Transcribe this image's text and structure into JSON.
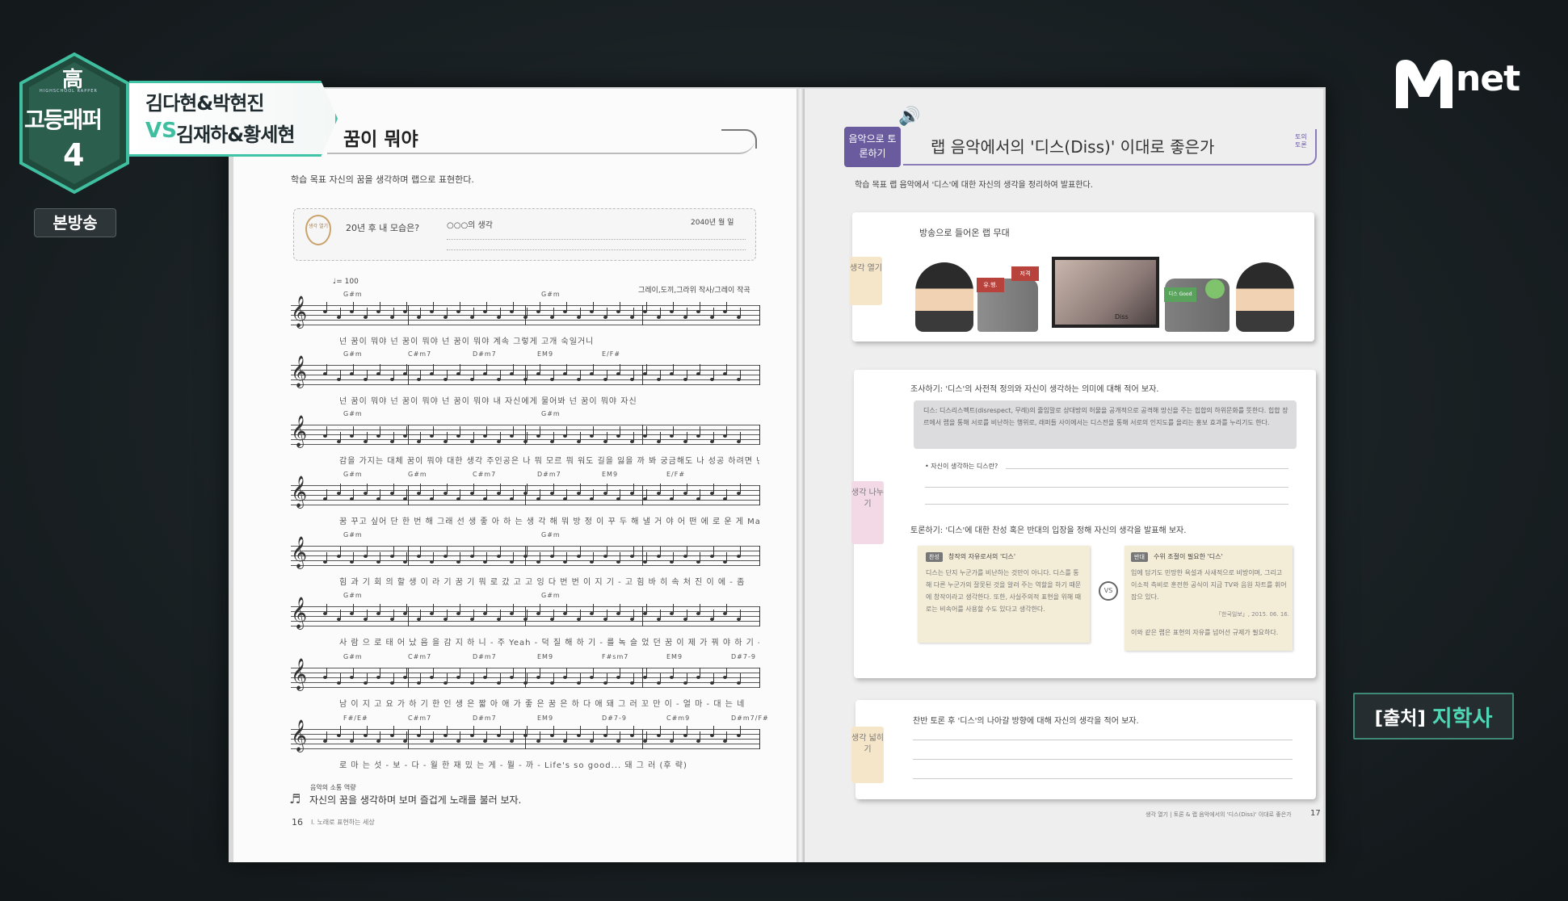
{
  "show": {
    "logo_top": "高",
    "logo_main": "고등래퍼",
    "logo_number": "4",
    "logo_sub": "HIGHSCHOOL RAPPER",
    "matchup_line1": "김다현&박현진",
    "vs_label": "VS",
    "matchup_line2": "김재하&황세현",
    "broadcast_badge": "본방송"
  },
  "channel_logo": "Mnet",
  "source": {
    "prefix": "[출처]",
    "name": "지학사"
  },
  "left_page": {
    "title": "꿈이 뭐야",
    "objective": "학습 목표    자신의 꿈을 생각하며 랩으로 표현한다.",
    "box_badge": "생각 열기",
    "box_question": "20년 후 내 모습은?",
    "box_name": "○○○의 생각",
    "box_year": "2040년  월  일",
    "tempo": "♩= 100",
    "credits": "그레이,도끼,그라위 작사/그레이 작곡",
    "footer_note_label": "음악의 소통 역량",
    "footer_note": "자신의 꿈을 생각하며 보며 즐겁게 노래를 불러 보자.",
    "page_number": "16",
    "footer_section": "Ⅰ. 노래로 표현하는 세상",
    "staff_lyrics": [
      "넌 꿈이 뭐야        넌 꿈이 뭐야        넌 꿈이 뭐야   계속   그렇게 고개 숙일거니",
      "넌 꿈이 뭐야        넌 꿈이 뭐야        넌 꿈이 뭐야   내   자신에게 물어봐 넌 꿈이 뭐야   자신",
      "감을 가지는 대체 꿈이 뭐야 대한   생각 주인공은 나 뭐 모르   뭐   워도 길을 잃을 까 봐 궁금해도 나 성공 하려면 넌 뭐 Why",
      "꿈 꾸고 싶어 단 한 번 해 그래   선 생 좋 아 하 는 생 각 해   뭐   방 정 이 꾸 두 해 낼 거 야   어 떤 에 로 운 게   Ma - ra-thon 하 기 는 위",
      "힘 과 기 회 의 할 생 이 라 기 꿈 기   뭐 로 갔 고 고 잉 다 번 번 이 지 기 - 고   힘  바  히  속  처 진 이 에 - 좀",
      "사 람 으 로 태 어 났 음 을 감 지 하 니 - 주   Yeah  -   덕 질 해 하 기 - 를   녹 슬 었 던 꿈 이 제 가 꿔 야 하 기 - 를",
      "남 이 지 고 요 가 하 기 한   인 생 은 짧 아 애 가 좋 은 꿈 은 하 다 애   돼 그 러   꼬 만 이 - 얼 마 -  대 는 네",
      "로 마 는 섯 - 보 - 다 -   월 한   재 밌 는 게 - 뭘 - 까 -  Life's  so  good...   돼 그 러   (후 략)"
    ],
    "chords": [
      [
        "G#m",
        "G#m"
      ],
      [
        "G#m",
        "C#m7",
        "D#m7",
        "EM9",
        "E/F#"
      ],
      [
        "G#m",
        "G#m"
      ],
      [
        "G#m",
        "G#m",
        "C#m7",
        "D#m7",
        "EM9",
        "E/F#"
      ],
      [
        "G#m",
        "G#m"
      ],
      [
        "G#m",
        "G#m"
      ],
      [
        "G#m",
        "C#m7",
        "D#m7",
        "EM9",
        "F#sm7",
        "EM9",
        "D#7-9"
      ],
      [
        "F#/E#",
        "C#m7",
        "D#m7",
        "EM9",
        "D#7-9",
        "C#m9",
        "D#m7/F#"
      ]
    ]
  },
  "right_page": {
    "corner_label": "음악으로 토론하기",
    "title": "랩 음악에서의 '디스(Diss)' 이대로 좋은가",
    "side_tag": "토의 토론",
    "objective": "학습 목표    랩 음악에서 '디스'에 대한 자신의 생각을 정리하여 발표한다.",
    "card1": {
      "tab": "생각 열기",
      "heading": "방송으로 들어온 랩 무대",
      "sign_left": "유.행.",
      "sign_right": "저격",
      "sign_green": "디스 Good",
      "tv_caption": "Diss"
    },
    "card2": {
      "tab": "생각 나누기",
      "research_heading": "조사하기: '디스'의 사전적 정의와 자신이 생각하는 의미에 대해 적어 보자.",
      "definition": "디스: 디스리스펙트(disrespect, 무례)의 줄임말로 상대방의 허물을 공개적으로 공격해 망신을 주는 힙합의 하위문화를 뜻한다. 힙합 장르에서 랩을 통해 서로를 비난하는 행위로, 래퍼들 사이에서는 디스전을 통해 서로의 인지도를 올리는 홍보 효과를 누리기도 한다.",
      "my_idea_label": "• 자신이 생각하는 디스란?",
      "debate_heading": "토론하기: '디스'에 대한 찬성 혹은 반대의 입장을 정해 자신의 생각을 발표해 보자.",
      "pro_badge": "찬성",
      "pro_title": "창작의 자유로서의 '디스'",
      "pro_text": "디스는 단지 누군가를 비난하는 것만이 아니다. 디스를 통해 다른 누군가의 잘못된 것을 알려 주는 역할을 하기 때문에 창작이라고 생각한다. 또한, 사실주의적 표현을 위해 때로는 비속어를 사용할 수도 있다고 생각한다.",
      "vs": "VS",
      "con_badge": "반대",
      "con_title": "수위 조절이 필요한 '디스'",
      "con_text": "입에 담기도 민망한 욕설과 사새적으로 비방이며, 그리고 이소적 측비로 훈전한 공식이 지금 TV와 음원 차트를 휘어잡으 있다.",
      "citation": "「한국일보」, 2015. 06. 16.",
      "con_text2": "이와 같은 랩은 표현의 자유를 넘어선 규제가 필요하다."
    },
    "card3": {
      "tab": "생각 넓히기",
      "heading": "찬반 토론 후 '디스'의 나아갈 방향에 대해 자신의 생각을 적어 보자."
    },
    "footer": "생각 열기 | 토론 & 랩 음악에서의 '디스(Diss)' 이대로 좋은가",
    "page_number": "17"
  },
  "colors": {
    "accent": "#40c4a8",
    "logo_green": "#2f6b55",
    "purple_tag": "#6a5a9e",
    "tab_pink": "#f3d9e6",
    "tab_yellow": "#f6e6c9"
  }
}
